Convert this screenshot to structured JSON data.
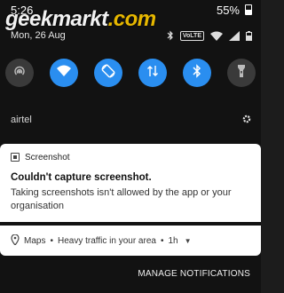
{
  "status_bar": {
    "time": "5:26",
    "battery": "55%"
  },
  "watermark": {
    "text_main": "geekmarkt",
    "text_dot": ".com"
  },
  "date_row": {
    "date": "Mon, 26 Aug",
    "volte_label": "VoLTE",
    "icons": [
      "bluetooth-icon",
      "volte-icon",
      "wifi-icon",
      "signal-icon",
      "battery-icon"
    ]
  },
  "quick_settings": {
    "tiles": [
      {
        "name": "hotspot",
        "icon": "hotspot-icon",
        "active": false
      },
      {
        "name": "wifi",
        "icon": "wifi-icon",
        "active": true
      },
      {
        "name": "auto-rotate",
        "icon": "auto-rotate-icon",
        "active": true
      },
      {
        "name": "mobile-data",
        "icon": "mobile-data-icon",
        "active": true
      },
      {
        "name": "bluetooth",
        "icon": "bluetooth-icon",
        "active": true
      },
      {
        "name": "flashlight",
        "icon": "flashlight-icon",
        "active": false
      }
    ],
    "accent_color": "#2a8ef0"
  },
  "carrier": {
    "name": "airtel"
  },
  "notifications": {
    "screenshot": {
      "app_name": "Screenshot",
      "title": "Couldn't capture screenshot.",
      "body": "Taking screenshots isn't allowed by the app or your organisation"
    },
    "maps": {
      "app_name": "Maps",
      "text": "Heavy traffic in your area",
      "separator": "•",
      "time": "1h"
    }
  },
  "footer": {
    "manage_label": "MANAGE NOTIFICATIONS"
  }
}
